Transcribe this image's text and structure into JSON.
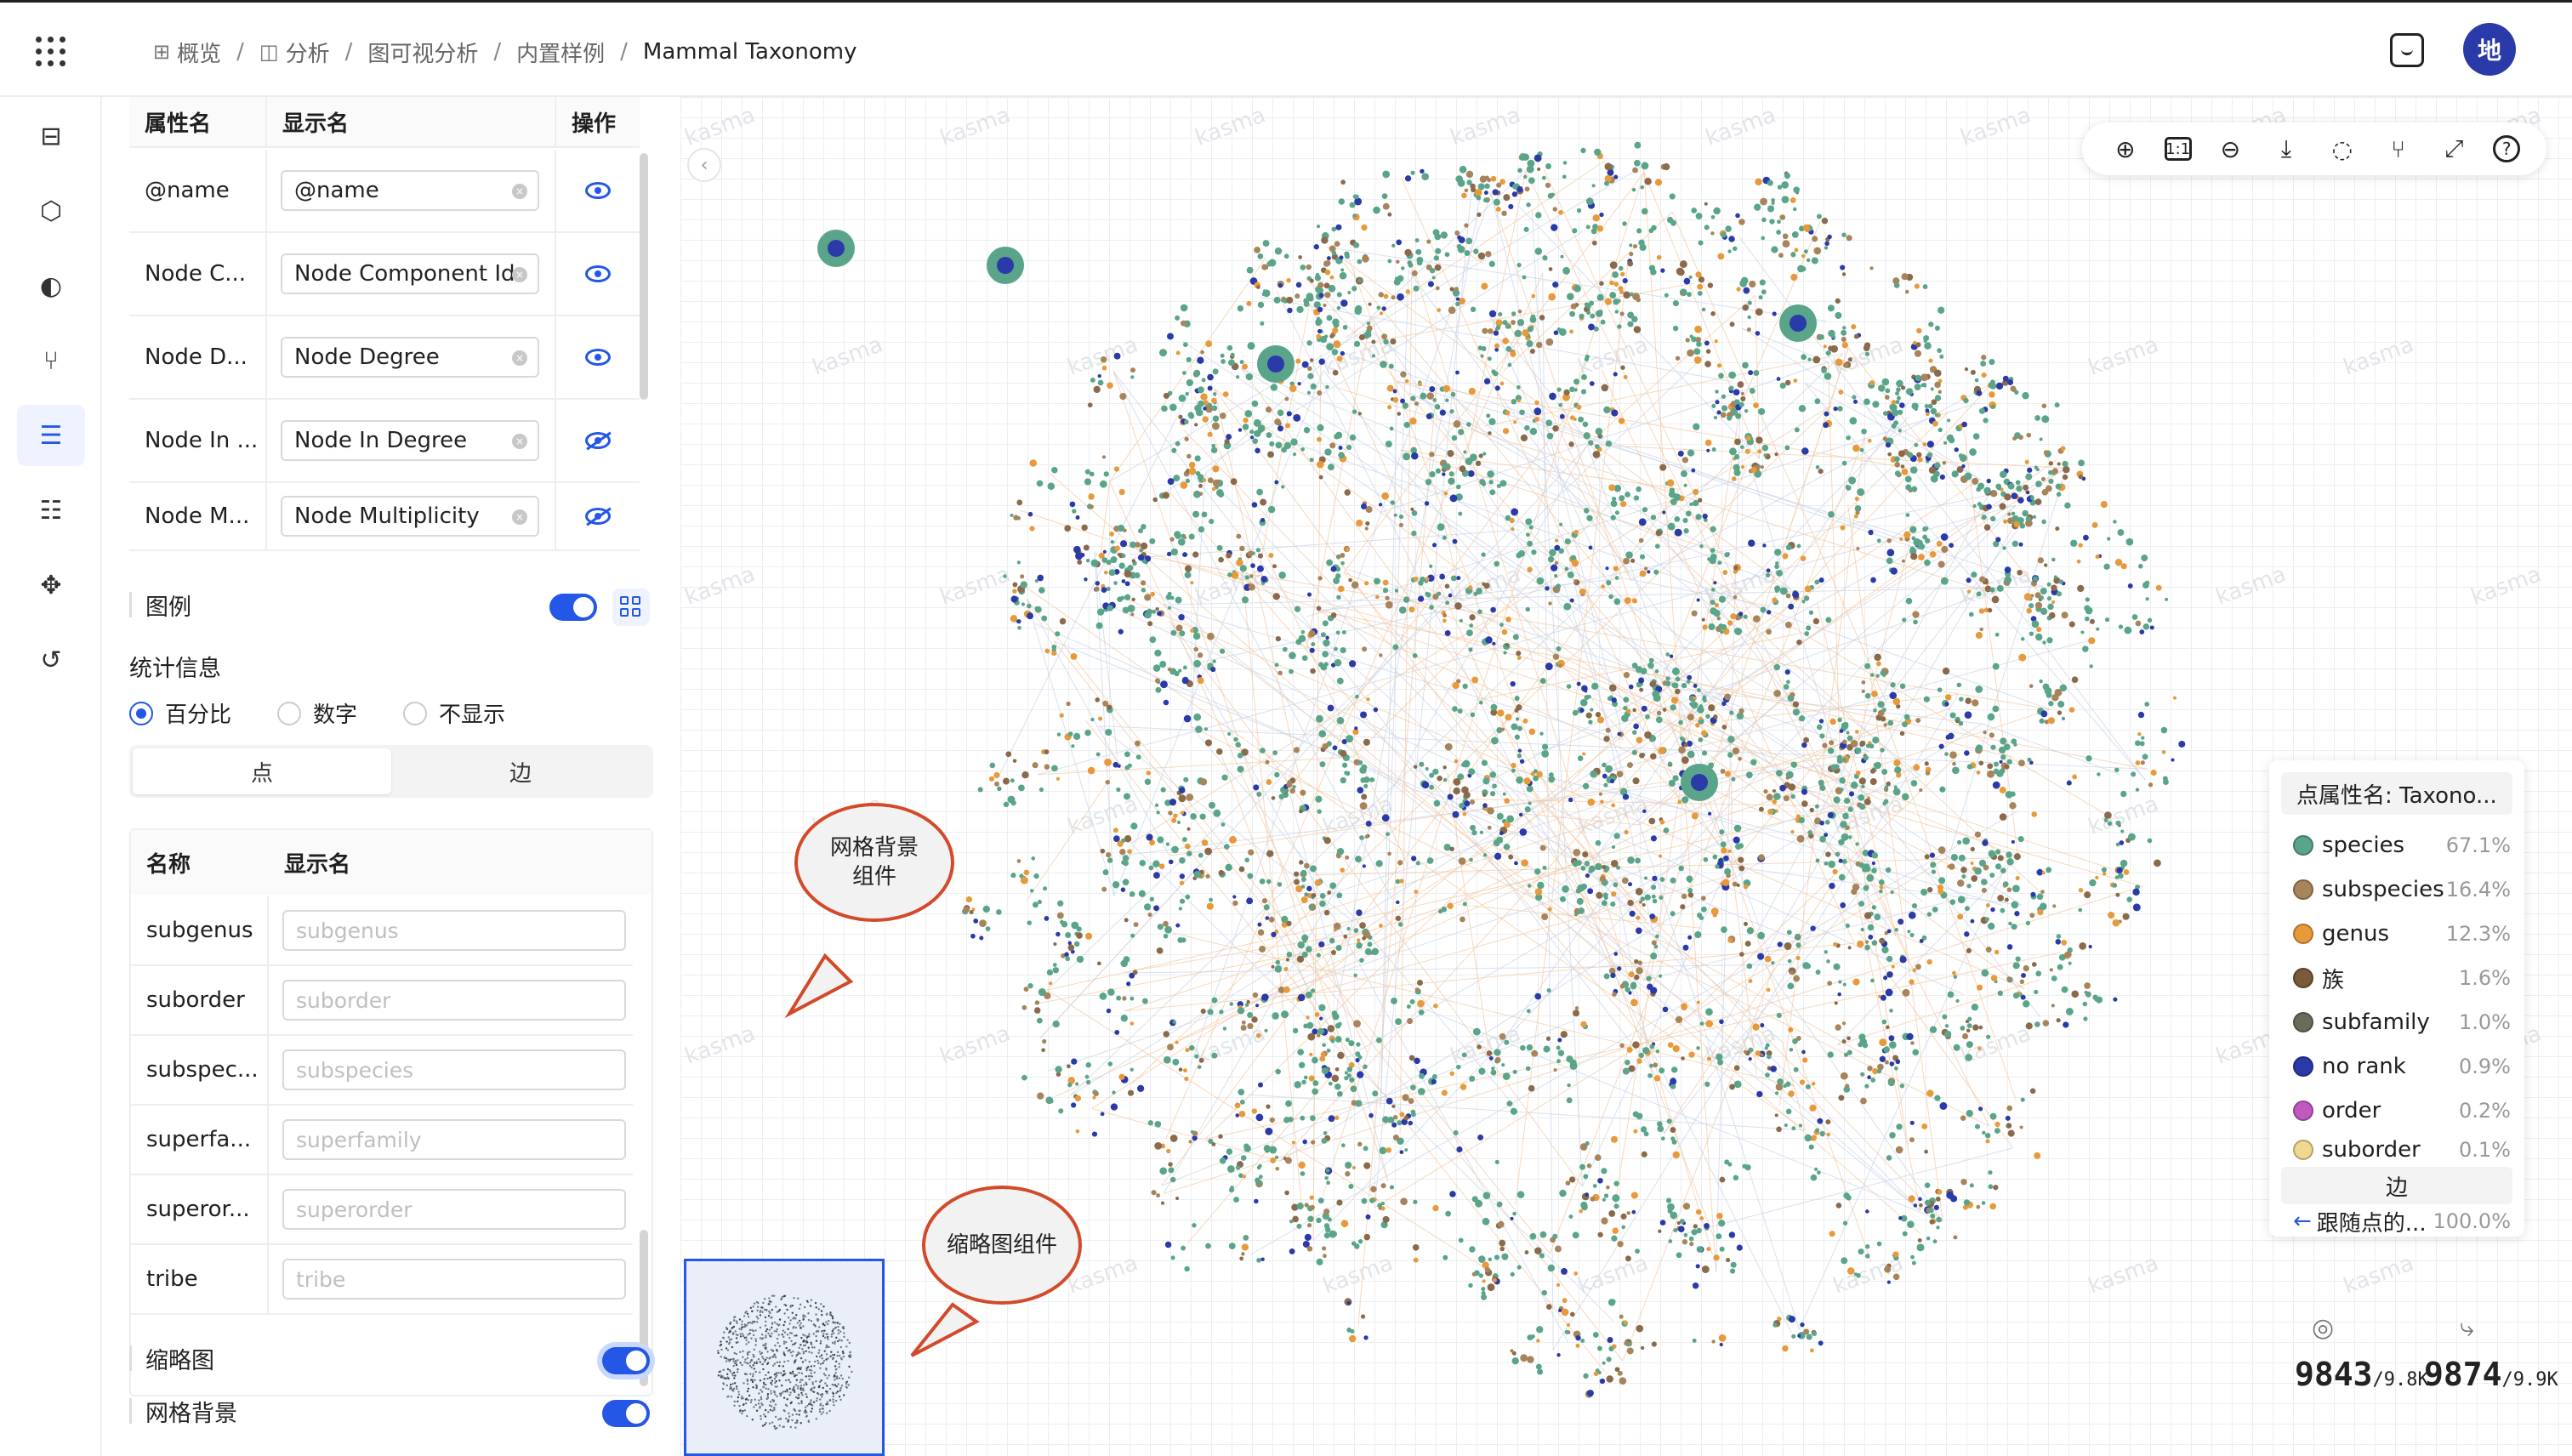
{
  "header": {
    "breadcrumb": [
      {
        "icon": "grid-icon",
        "label": "概览"
      },
      {
        "icon": "chart-icon",
        "label": "分析"
      },
      {
        "icon": "",
        "label": "图可视分析"
      },
      {
        "icon": "",
        "label": "内置样例"
      },
      {
        "icon": "",
        "label": "Mammal Taxonomy"
      }
    ],
    "avatar_text": "地"
  },
  "attr_table": {
    "col_name": "属性名",
    "col_display": "显示名",
    "col_action": "操作",
    "rows": [
      {
        "name": "@name",
        "display": "@name",
        "visible": true
      },
      {
        "name": "Node C...",
        "display": "Node Component Id",
        "visible": true
      },
      {
        "name": "Node D...",
        "display": "Node Degree",
        "visible": true
      },
      {
        "name": "Node In ...",
        "display": "Node In Degree",
        "visible": false
      },
      {
        "name": "Node M...",
        "display": "Node Multiplicity",
        "visible": false
      }
    ]
  },
  "legend_section": {
    "label": "图例",
    "enabled": true,
    "stats_label": "统计信息",
    "stats_options": [
      "百分比",
      "数字",
      "不显示"
    ],
    "stats_selected": "百分比",
    "tabs": [
      "点",
      "边"
    ],
    "active_tab": "点"
  },
  "name_table": {
    "col_name": "名称",
    "col_display": "显示名",
    "rows": [
      {
        "name": "subgenus",
        "placeholder": "subgenus"
      },
      {
        "name": "suborder",
        "placeholder": "suborder"
      },
      {
        "name": "subspec...",
        "placeholder": "subspecies"
      },
      {
        "name": "superfa...",
        "placeholder": "superfamily"
      },
      {
        "name": "superor...",
        "placeholder": "superorder"
      },
      {
        "name": "tribe",
        "placeholder": "tribe"
      }
    ]
  },
  "minimap_section": {
    "label": "缩略图",
    "enabled": true
  },
  "grid_section": {
    "label": "网格背景",
    "enabled": true
  },
  "canvas": {
    "watermark": "kasma",
    "callout_grid": "网格背景\n组件",
    "callout_minimap": "缩略图组件"
  },
  "legend": {
    "title": "点属性名: Taxono...",
    "items": [
      {
        "name": "species",
        "pct": "67.1%",
        "color": "#5aa58a"
      },
      {
        "name": "subspecies",
        "pct": "16.4%",
        "color": "#a8845a"
      },
      {
        "name": "genus",
        "pct": "12.3%",
        "color": "#e89a3a"
      },
      {
        "name": "族",
        "pct": "1.6%",
        "color": "#7a5a3a"
      },
      {
        "name": "subfamily",
        "pct": "1.0%",
        "color": "#6b6b5a"
      },
      {
        "name": "no rank",
        "pct": "0.9%",
        "color": "#2a3aa8"
      },
      {
        "name": "order",
        "pct": "0.2%",
        "color": "#c05ac0"
      },
      {
        "name": "suborder",
        "pct": "0.1%",
        "color": "#f0d890"
      }
    ],
    "edge_title": "边",
    "edge_item": {
      "name": "跟随点的...",
      "pct": "100.0%"
    }
  },
  "stats": {
    "nodes_shown": "9843",
    "nodes_total": "9.8K",
    "edges_shown": "9874",
    "edges_total": "9.9K"
  },
  "colors": {
    "accent": "#2457e6",
    "node_green": "#5aa58a",
    "node_orange": "#e89a3a",
    "node_brown": "#8a6a4a",
    "node_navy": "#2a3aa8",
    "callout_border": "#d24a2a"
  }
}
